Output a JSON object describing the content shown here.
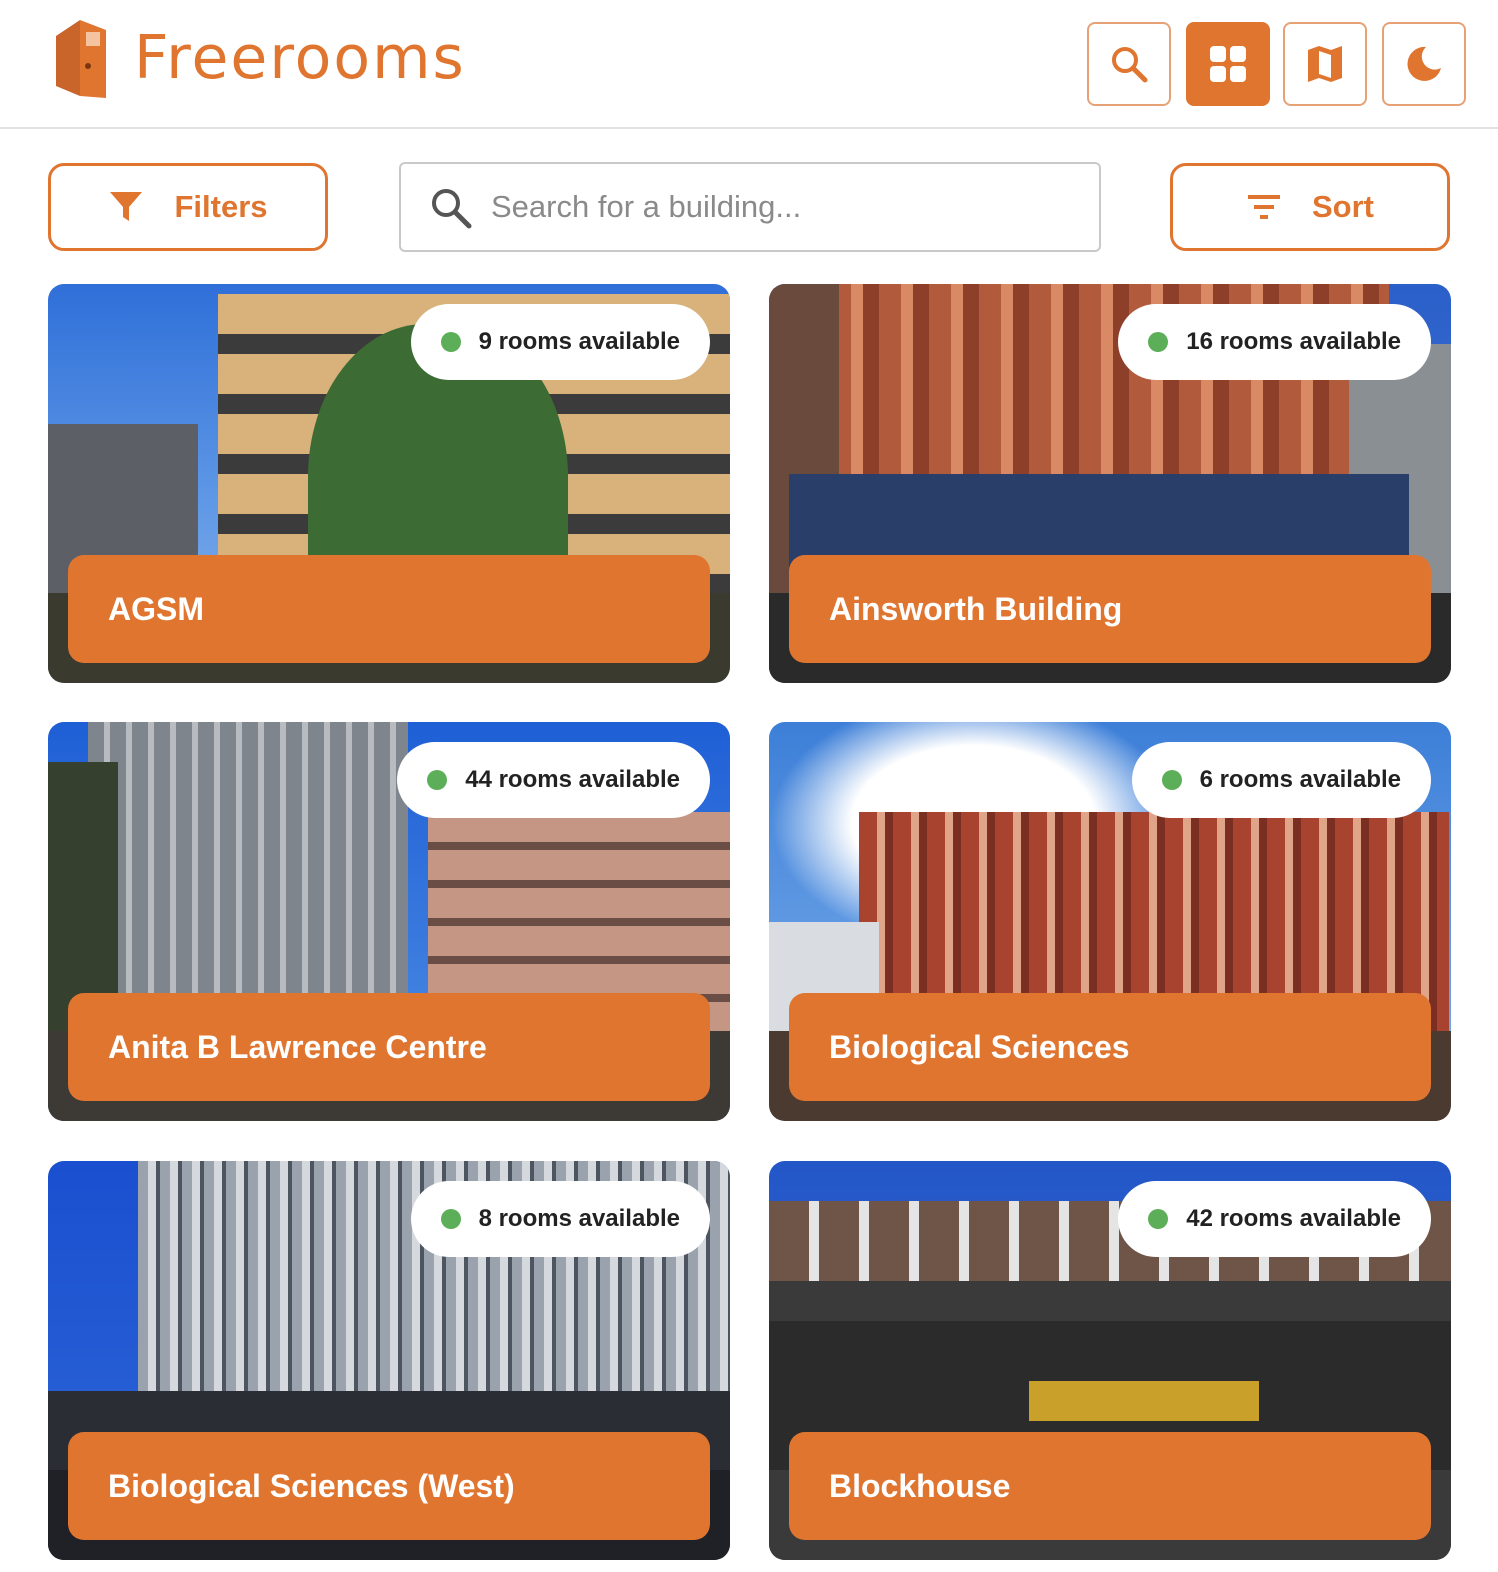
{
  "app": {
    "name": "Freerooms"
  },
  "header": {
    "buttons": [
      {
        "icon": "search-icon"
      },
      {
        "icon": "grid-icon",
        "active": true
      },
      {
        "icon": "map-icon"
      },
      {
        "icon": "moon-icon"
      }
    ]
  },
  "toolbar": {
    "filters_label": "Filters",
    "sort_label": "Sort",
    "search_placeholder": "Search for a building...",
    "search_value": ""
  },
  "colors": {
    "accent": "#e07530",
    "available": "#5cae58"
  },
  "buildings": [
    {
      "name": "AGSM",
      "availability": "9 rooms available"
    },
    {
      "name": "Ainsworth Building",
      "availability": "16 rooms available"
    },
    {
      "name": "Anita B Lawrence Centre",
      "availability": "44 rooms available"
    },
    {
      "name": "Biological Sciences",
      "availability": "6 rooms available"
    },
    {
      "name": "Biological Sciences (West)",
      "availability": "8 rooms available"
    },
    {
      "name": "Blockhouse",
      "availability": "42 rooms available"
    }
  ]
}
